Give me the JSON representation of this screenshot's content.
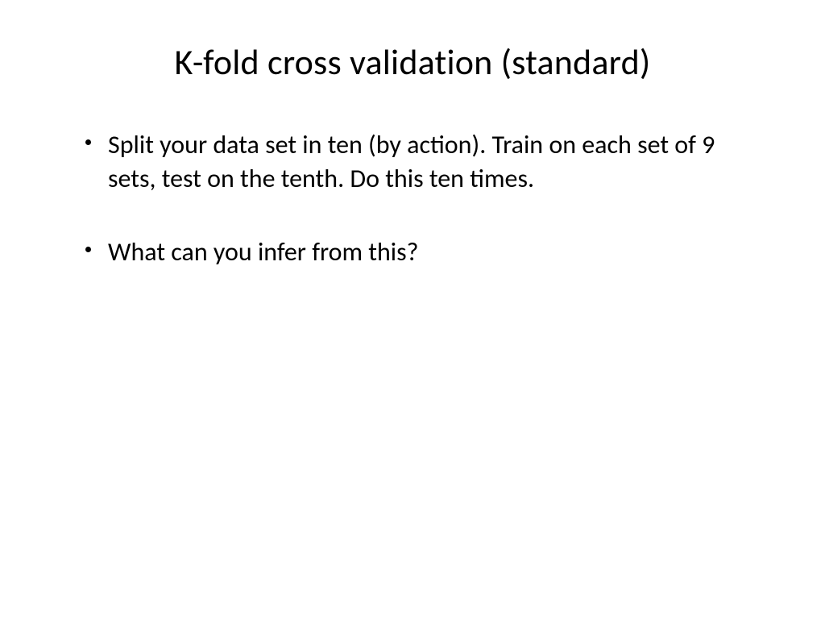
{
  "slide": {
    "title": "K-fold cross validation (standard)",
    "bullets": [
      "Split your data set in ten (by action). Train on each set of 9 sets, test on the tenth. Do this ten times.",
      "What can you infer from this?"
    ]
  }
}
